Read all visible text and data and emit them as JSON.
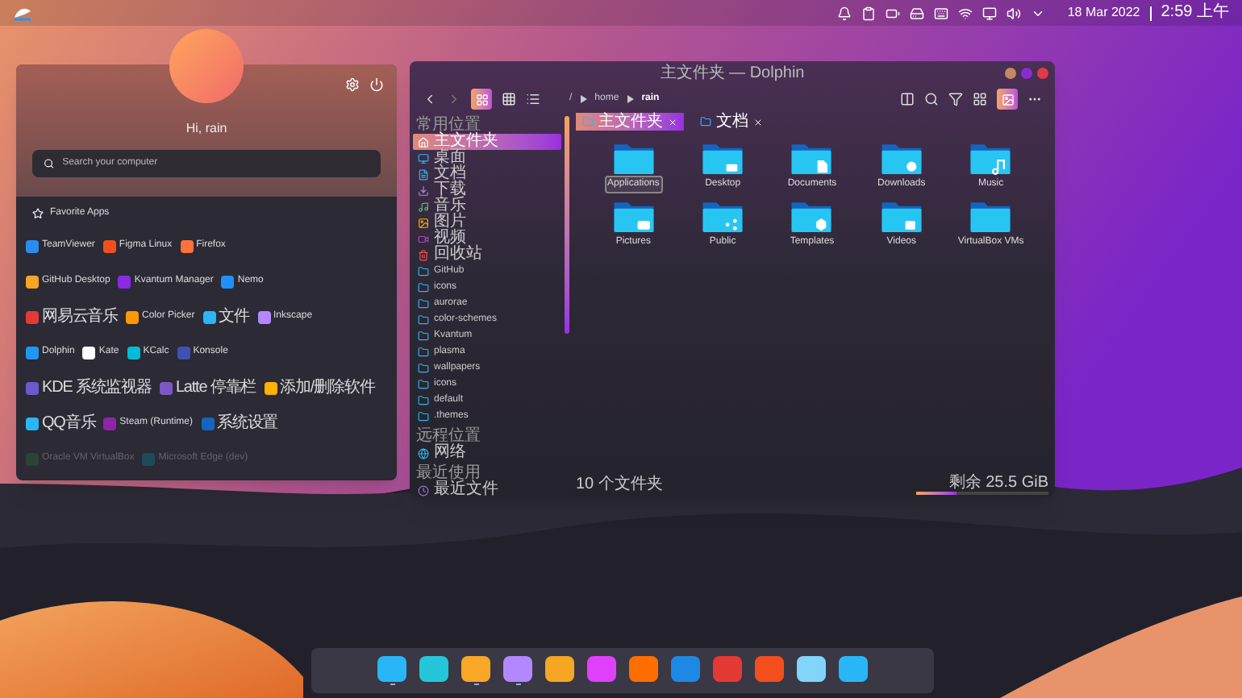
{
  "top_bar": {
    "date": "18 Mar 2022",
    "time": "2:59 上午"
  },
  "launcher": {
    "greeting": "Hi, rain",
    "search": {
      "placeholder": "Search your computer"
    },
    "section_title": "Favorite Apps",
    "app_rows": [
      [
        {
          "name": "TeamViewer",
          "faded": false
        },
        {
          "name": "Figma Linux",
          "faded": false
        },
        {
          "name": "Firefox",
          "faded": false
        }
      ],
      [
        {
          "name": "GitHub Desktop",
          "faded": false
        },
        {
          "name": "Kvantum Manager",
          "faded": false
        },
        {
          "name": "Nemo",
          "faded": false
        }
      ],
      [
        {
          "name": "网易云音乐",
          "faded": false
        },
        {
          "name": "Color Picker",
          "faded": false
        },
        {
          "name": "文件",
          "faded": false
        },
        {
          "name": "Inkscape",
          "faded": false
        }
      ],
      [
        {
          "name": "Dolphin",
          "faded": false
        },
        {
          "name": "Kate",
          "faded": false
        },
        {
          "name": "KCalc",
          "faded": false
        },
        {
          "name": "Konsole",
          "faded": false
        }
      ],
      [
        {
          "name": "KDE 系统监视器",
          "faded": false
        },
        {
          "name": "Latte 停靠栏",
          "faded": false
        },
        {
          "name": "添加/删除软件",
          "faded": false
        }
      ],
      [
        {
          "name": "QQ音乐",
          "faded": false
        },
        {
          "name": "Steam (Runtime)",
          "faded": false
        },
        {
          "name": "系统设置",
          "faded": false
        }
      ],
      [
        {
          "name": "Oracle VM VirtualBox",
          "faded": true
        },
        {
          "name": "Microsoft Edge (dev)",
          "faded": true
        }
      ]
    ]
  },
  "dolphin": {
    "title": "主文件夹 — Dolphin",
    "breadcrumb": [
      "/",
      "home",
      "rain"
    ],
    "tabs": [
      {
        "label": "主文件夹",
        "selected": true
      },
      {
        "label": "文档",
        "selected": false
      }
    ],
    "places": [
      {
        "heading": "常用位置",
        "items": [
          {
            "label": "主文件夹",
            "kind": "home",
            "selected": true
          },
          {
            "label": "桌面",
            "kind": "desktop",
            "selected": false
          },
          {
            "label": "文档",
            "kind": "documents",
            "selected": false
          },
          {
            "label": "下载",
            "kind": "downloads",
            "selected": false
          },
          {
            "label": "音乐",
            "kind": "music",
            "selected": false
          },
          {
            "label": "图片",
            "kind": "pictures",
            "selected": false
          },
          {
            "label": "视频",
            "kind": "videos",
            "selected": false
          },
          {
            "label": "回收站",
            "kind": "trash",
            "selected": false
          },
          {
            "label": "GitHub",
            "kind": "folder",
            "selected": false
          },
          {
            "label": "icons",
            "kind": "folder",
            "selected": false
          },
          {
            "label": "aurorae",
            "kind": "folder",
            "selected": false
          },
          {
            "label": "color-schemes",
            "kind": "folder",
            "selected": false
          },
          {
            "label": "Kvantum",
            "kind": "folder",
            "selected": false
          },
          {
            "label": "plasma",
            "kind": "folder",
            "selected": false
          },
          {
            "label": "wallpapers",
            "kind": "folder",
            "selected": false
          },
          {
            "label": "icons",
            "kind": "folder",
            "selected": false
          },
          {
            "label": "default",
            "kind": "folder",
            "selected": false
          },
          {
            "label": ".themes",
            "kind": "folder",
            "selected": false
          }
        ]
      },
      {
        "heading": "远程位置",
        "items": [
          {
            "label": "网络",
            "kind": "network",
            "selected": false
          }
        ]
      },
      {
        "heading": "最近使用",
        "items": [
          {
            "label": "最近文件",
            "kind": "recent",
            "selected": false
          }
        ]
      }
    ],
    "files": [
      {
        "name": "Applications",
        "kind": "plain",
        "selected": true
      },
      {
        "name": "Desktop",
        "kind": "desktop",
        "selected": false
      },
      {
        "name": "Documents",
        "kind": "document",
        "selected": false
      },
      {
        "name": "Downloads",
        "kind": "download",
        "selected": false
      },
      {
        "name": "Music",
        "kind": "music",
        "selected": false
      },
      {
        "name": "Pictures",
        "kind": "camera",
        "selected": false
      },
      {
        "name": "Public",
        "kind": "share",
        "selected": false
      },
      {
        "name": "Templates",
        "kind": "template",
        "selected": false
      },
      {
        "name": "Videos",
        "kind": "video",
        "selected": false
      },
      {
        "name": "VirtualBox VMs",
        "kind": "plain",
        "selected": false
      }
    ],
    "status": "10 个文件夹",
    "free_space": {
      "label": "剩余 25.5 GiB",
      "level": 0.3
    }
  },
  "dock": [
    {
      "running": true
    },
    {
      "running": false
    },
    {
      "running": true
    },
    {
      "running": true
    },
    {
      "running": false
    },
    {
      "running": false
    },
    {
      "running": false
    },
    {
      "running": false
    },
    {
      "running": false
    },
    {
      "running": false
    },
    {
      "running": false
    },
    {
      "running": false
    }
  ]
}
